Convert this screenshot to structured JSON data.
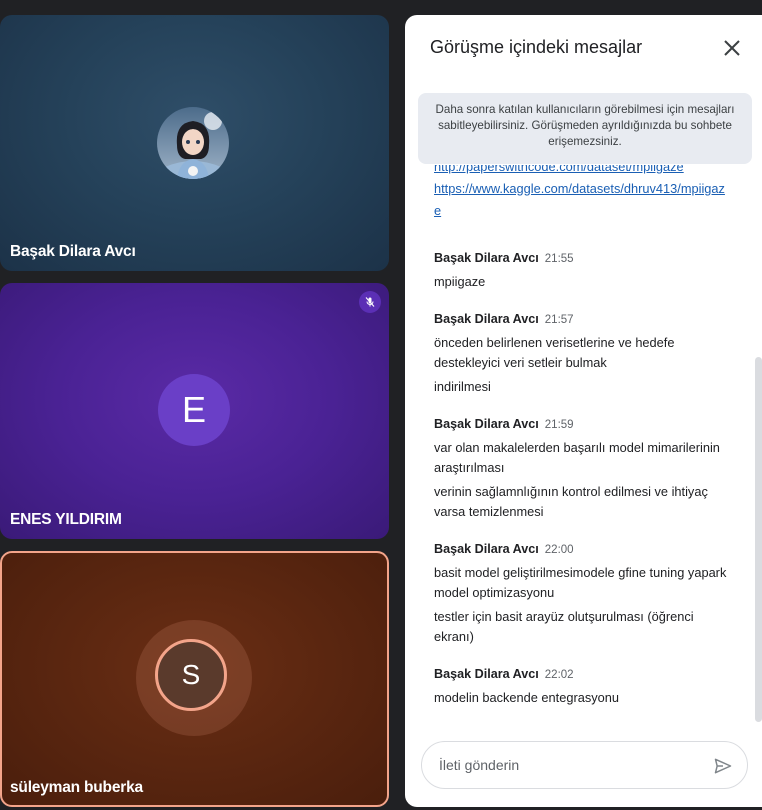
{
  "participants": [
    {
      "name": "Başak Dilara Avcı"
    },
    {
      "name": "ENES YILDIRIM",
      "initial": "E",
      "muted_icon": "mic-off-icon"
    },
    {
      "name": "süleyman buberka",
      "initial": "S"
    }
  ],
  "chat": {
    "title": "Görüşme içindeki mesajlar",
    "pin_note": "Daha sonra katılan kullanıcıların görebilmesi için mesajları sabitleyebilirsiniz. Görüşmeden ayrıldığınızda bu sohbete erişemezsiniz.",
    "links": [
      "http://paperswithcode.com/dataset/mpiigaze",
      "https://www.kaggle.com/datasets/dhruv413/mpiigaze"
    ],
    "messages": [
      {
        "sender": "Başak Dilara Avcı",
        "time": "21:55",
        "lines": [
          "mpiigaze"
        ]
      },
      {
        "sender": "Başak Dilara Avcı",
        "time": "21:57",
        "lines": [
          "önceden belirlenen verisetlerine ve hedefe destekleyici veri setleir bulmak",
          "indirilmesi"
        ]
      },
      {
        "sender": "Başak Dilara Avcı",
        "time": "21:59",
        "lines": [
          "var olan makalelerden başarılı model mimarilerinin araştırılması",
          "verinin sağlamnlığının kontrol edilmesi ve ihtiyaç varsa temizlenmesi"
        ]
      },
      {
        "sender": "Başak Dilara Avcı",
        "time": "22:00",
        "lines": [
          "basit model geliştirilmesimodele gfine tuning yapark model optimizasyonu",
          "testler için basit arayüz olutşurulması (öğrenci ekranı)"
        ]
      },
      {
        "sender": "Başak Dilara Avcı",
        "time": "22:02",
        "lines": [
          "modelin backende entegrasyonu"
        ]
      }
    ],
    "input_placeholder": "İleti gönderin"
  },
  "colors": {
    "accent_border": "#f3a48a",
    "link": "#1a5fb4",
    "muted_badge": "#5b2fb5"
  }
}
